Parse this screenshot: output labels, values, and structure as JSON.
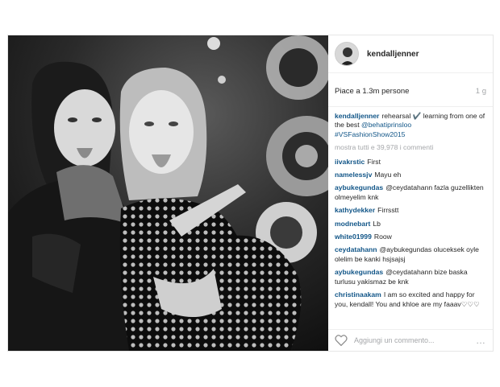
{
  "post": {
    "username": "kendalljenner",
    "likes_text": "Piace a 1.3m persone",
    "time_text": "1 g",
    "caption": {
      "user": "kendalljenner",
      "text": "rehearsal ✔️ learning from one of the best ",
      "mention": "@behatiprinsloo",
      "hashtag": "#VSFashionShow2015"
    },
    "view_all_text": "mostra tutti e 39,978 i commenti",
    "comments": [
      {
        "user": "iivakrstic",
        "text": "First"
      },
      {
        "user": "namelessjv",
        "text": "Mayu eh"
      },
      {
        "user": "aybukegundas",
        "text": "@ceydatahann fazla guzellikten olmeyelim knk"
      },
      {
        "user": "kathydekker",
        "text": "Firrsstt"
      },
      {
        "user": "modnebart",
        "text": "Lb"
      },
      {
        "user": "white01999",
        "text": "Roow"
      },
      {
        "user": "ceydatahann",
        "text": "@aybukegundas oluceksek oyle olelim be kanki hsjsajsj"
      },
      {
        "user": "aybukegundas",
        "text": "@ceydatahann bize baska turlusu yakismaz be knk"
      },
      {
        "user": "christinaakam",
        "text": "I am so excited and happy for you, kendall! You and khloe are my faaav♡♡♡"
      }
    ],
    "add_comment_placeholder": "Aggiungi un commento...",
    "more_icon": "…"
  }
}
